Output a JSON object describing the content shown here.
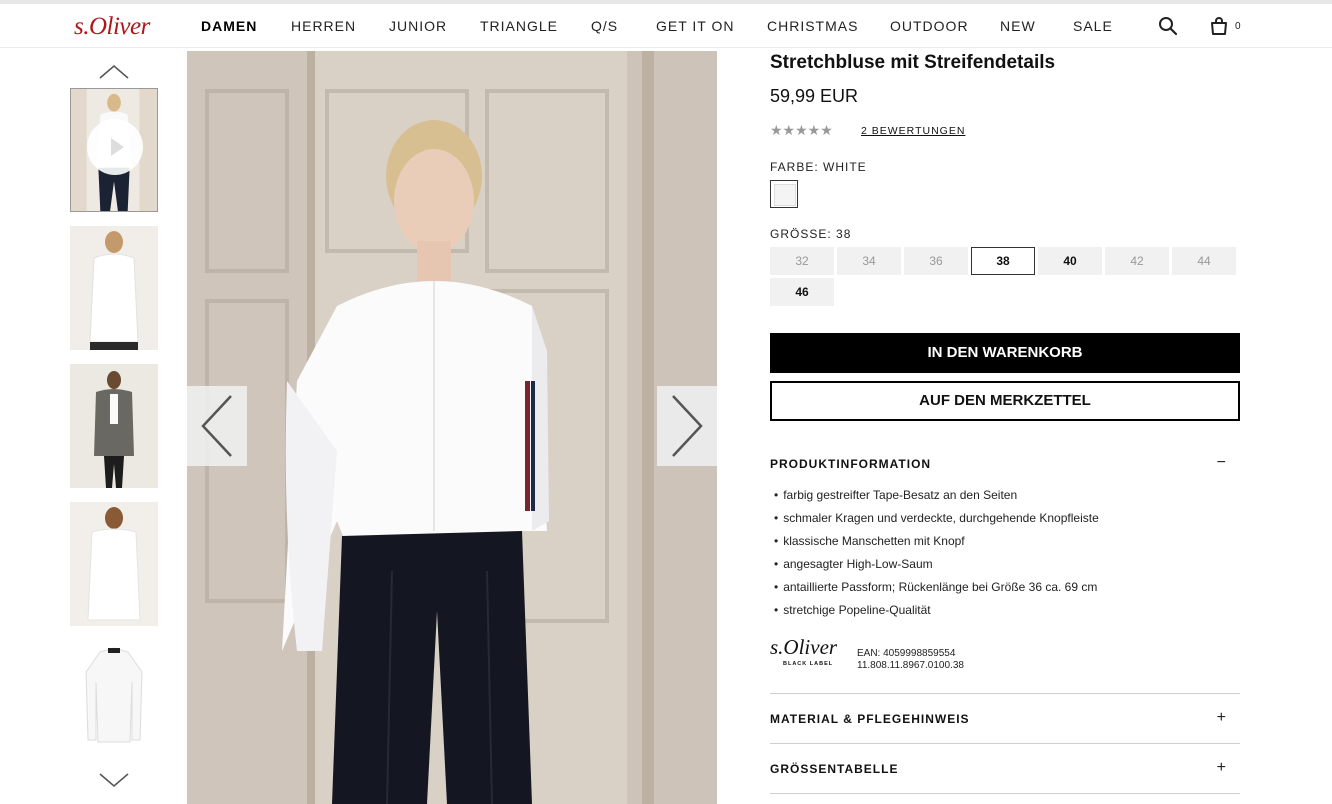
{
  "header": {
    "logo": "s.Oliver",
    "nav": [
      {
        "label": "DAMEN",
        "active": true
      },
      {
        "label": "HERREN",
        "active": false
      },
      {
        "label": "JUNIOR",
        "active": false
      },
      {
        "label": "TRIANGLE",
        "active": false
      },
      {
        "label": "Q/S",
        "active": false
      },
      {
        "label": "GET IT ON",
        "active": false
      },
      {
        "label": "CHRISTMAS",
        "active": false
      },
      {
        "label": "OUTDOOR",
        "active": false
      },
      {
        "label": "NEW",
        "active": false
      },
      {
        "label": "SALE",
        "active": false
      }
    ],
    "icons": [
      "search-icon",
      "shopping-bag-icon"
    ],
    "cart_count": "0"
  },
  "gallery": {
    "thumbnails": [
      "video-thumbnail",
      "front-view",
      "coat-outfit",
      "back-view",
      "product-only"
    ],
    "selected_thumbnail": 0
  },
  "product": {
    "title": "Stretchbluse mit Streifendetails",
    "price": "59,99 EUR",
    "rating_stars": "★★★★★",
    "reviews_link": "2 BEWERTUNGEN",
    "color_label": "FARBE: WHITE",
    "color_value": "#f4f4f4",
    "size_label": "GRÖSSE: 38",
    "sizes": [
      {
        "label": "32",
        "available": false
      },
      {
        "label": "34",
        "available": false
      },
      {
        "label": "36",
        "available": false
      },
      {
        "label": "38",
        "available": true,
        "selected": true
      },
      {
        "label": "40",
        "available": true
      },
      {
        "label": "42",
        "available": false
      },
      {
        "label": "44",
        "available": false
      },
      {
        "label": "46",
        "available": true
      }
    ],
    "add_to_cart": "IN DEN WARENKORB",
    "add_to_wishlist": "AUF DEN MERKZETTEL"
  },
  "accordions": {
    "info": {
      "title": "PRODUKTINFORMATION",
      "sign": "−"
    },
    "care": {
      "title": "MATERIAL & PFLEGEHINWEIS",
      "sign": "+"
    },
    "sizes": {
      "title": "GRÖSSENTABELLE",
      "sign": "+"
    }
  },
  "product_info": {
    "bullets": [
      "farbig gestreifter Tape-Besatz an den Seiten",
      "schmaler Kragen und verdeckte, durchgehende Knopfleiste",
      "klassische Manschetten mit Knopf",
      "angesagter High-Low-Saum",
      "antaillierte Passform; Rückenlänge bei Größe 36 ca. 69 cm",
      "stretchige Popeline-Qualität"
    ],
    "brand_logo": "s.Oliver",
    "brand_sub": "BLACK LABEL",
    "ean": "EAN: 4059998859554",
    "article_no": "11.808.11.8967.0100.38"
  },
  "colors": {
    "brand_red": "#b1151b",
    "cart_button": "#000000"
  }
}
